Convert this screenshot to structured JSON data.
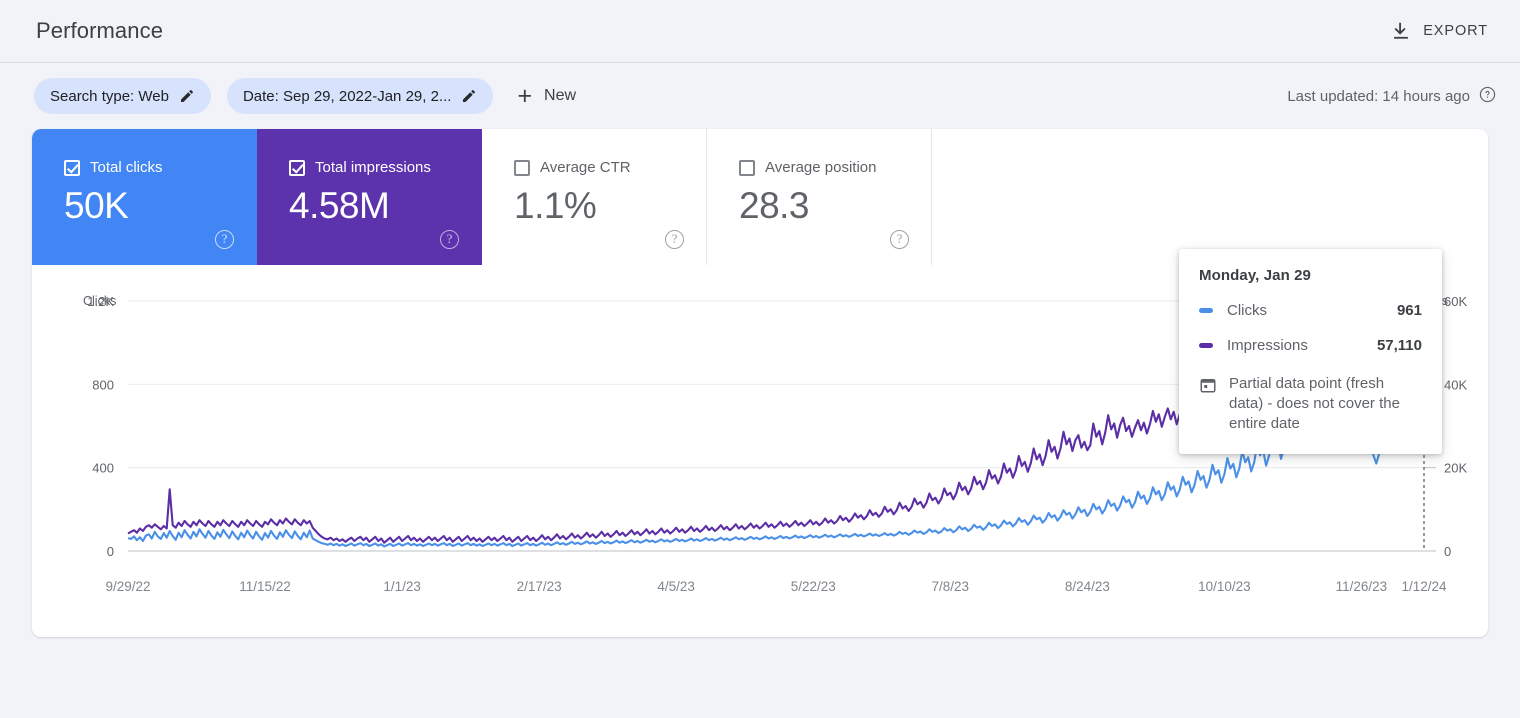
{
  "header": {
    "title": "Performance",
    "export_label": "EXPORT",
    "export_icon": "download-icon"
  },
  "filters": {
    "chips": [
      {
        "label": "Search type: Web",
        "icon": "pencil-icon"
      },
      {
        "label": "Date: Sep 29, 2022-Jan 29, 2...",
        "icon": "pencil-icon"
      }
    ],
    "new_label": "New",
    "new_icon": "plus-icon",
    "last_updated": "Last updated: 14 hours ago",
    "help_icon": "help-circle-icon"
  },
  "metrics": [
    {
      "name": "total-clicks",
      "label": "Total clicks",
      "value": "50K",
      "checked": true,
      "style": "blue",
      "color": "#4285f4"
    },
    {
      "name": "total-impressions",
      "label": "Total impressions",
      "value": "4.58M",
      "checked": true,
      "style": "purple",
      "color": "#5c33ad"
    },
    {
      "name": "average-ctr",
      "label": "Average CTR",
      "value": "1.1%",
      "checked": false,
      "style": "plain",
      "color": "#5f6368"
    },
    {
      "name": "average-position",
      "label": "Average position",
      "value": "28.3",
      "checked": false,
      "style": "plain",
      "color": "#5f6368"
    }
  ],
  "tooltip": {
    "title": "Monday, Jan 29",
    "rows": [
      {
        "name": "Clicks",
        "value": "961",
        "color": "#4a90e8"
      },
      {
        "name": "Impressions",
        "value": "57,110",
        "color": "#5b2ea6"
      }
    ],
    "note": "Partial data point (fresh data) - does not cover the entire date",
    "note_icon": "calendar-icon"
  },
  "chart_data": {
    "type": "line",
    "title": "",
    "xlabel": "",
    "ylabel": "Clicks",
    "y2label": "Impressions",
    "grid": true,
    "legend": "none",
    "y_left_ticks": [
      "0",
      "400",
      "800",
      "1.2K"
    ],
    "y_left_values": [
      0,
      400,
      800,
      1200
    ],
    "ylim": [
      0,
      1200
    ],
    "y_right_ticks": [
      "0",
      "20K",
      "40K",
      "60K"
    ],
    "y_right_values": [
      0,
      20000,
      40000,
      60000
    ],
    "y2lim": [
      0,
      60000
    ],
    "x_ticks": [
      "9/29/22",
      "11/15/22",
      "1/1/23",
      "2/17/23",
      "4/5/23",
      "5/22/23",
      "7/8/23",
      "8/24/23",
      "10/10/23",
      "11/26/23",
      "1/12/24"
    ],
    "x_range": [
      "9/29/22",
      "1/29/24"
    ],
    "highlight": {
      "x": "1/29/24",
      "clicks": 961,
      "impressions": 57110
    },
    "series": [
      {
        "name": "Clicks",
        "color": "#4a90e8",
        "axis": "left",
        "values": [
          62,
          58,
          70,
          52,
          66,
          48,
          74,
          80,
          60,
          92,
          70,
          58,
          86,
          64,
          96,
          72,
          54,
          88,
          66,
          100,
          78,
          60,
          92,
          70,
          104,
          82,
          64,
          96,
          74,
          58,
          90,
          68,
          102,
          80,
          62,
          94,
          72,
          56,
          88,
          66,
          98,
          76,
          60,
          92,
          70,
          54,
          86,
          64,
          96,
          74,
          58,
          90,
          68,
          100,
          78,
          62,
          94,
          72,
          56,
          88,
          66,
          98,
          60,
          52,
          44,
          38,
          34,
          30,
          36,
          28,
          34,
          26,
          32,
          24,
          30,
          36,
          26,
          32,
          38,
          28,
          34,
          24,
          30,
          36,
          26,
          32,
          22,
          28,
          34,
          24,
          30,
          36,
          26,
          32,
          38,
          28,
          34,
          26,
          32,
          24,
          30,
          36,
          28,
          34,
          26,
          32,
          38,
          28,
          34,
          24,
          30,
          36,
          26,
          32,
          38,
          28,
          34,
          26,
          32,
          24,
          30,
          36,
          28,
          34,
          26,
          32,
          38,
          28,
          34,
          24,
          30,
          36,
          26,
          32,
          38,
          28,
          34,
          26,
          32,
          40,
          30,
          36,
          28,
          34,
          42,
          32,
          38,
          30,
          36,
          44,
          34,
          40,
          32,
          38,
          46,
          36,
          42,
          34,
          40,
          48,
          38,
          44,
          36,
          42,
          50,
          40,
          46,
          38,
          44,
          52,
          42,
          48,
          40,
          46,
          54,
          44,
          50,
          42,
          48,
          56,
          46,
          52,
          44,
          50,
          58,
          48,
          54,
          46,
          52,
          60,
          50,
          56,
          48,
          54,
          62,
          52,
          58,
          50,
          56,
          64,
          54,
          60,
          52,
          58,
          66,
          56,
          62,
          54,
          60,
          68,
          58,
          64,
          56,
          62,
          70,
          60,
          66,
          58,
          64,
          72,
          62,
          68,
          60,
          66,
          74,
          64,
          70,
          62,
          68,
          76,
          66,
          72,
          64,
          70,
          78,
          68,
          74,
          66,
          72,
          80,
          70,
          76,
          68,
          74,
          82,
          72,
          78,
          70,
          76,
          84,
          74,
          80,
          72,
          78,
          86,
          76,
          82,
          74,
          80,
          92,
          82,
          88,
          78,
          86,
          98,
          88,
          94,
          82,
          90,
          104,
          92,
          98,
          86,
          94,
          110,
          98,
          104,
          90,
          100,
          118,
          104,
          112,
          96,
          106,
          126,
          112,
          118,
          102,
          114,
          136,
          120,
          128,
          110,
          122,
          146,
          130,
          138,
          118,
          132,
          158,
          140,
          148,
          126,
          142,
          170,
          152,
          160,
          136,
          152,
          182,
          162,
          172,
          146,
          164,
          196,
          174,
          184,
          156,
          176,
          210,
          186,
          198,
          168,
          188,
          226,
          200,
          212,
          180,
          202,
          244,
          216,
          228,
          194,
          218,
          262,
          234,
          246,
          208,
          234,
          284,
          252,
          266,
          226,
          252,
          306,
          272,
          288,
          244,
          272,
          330,
          294,
          310,
          262,
          294,
          356,
          318,
          334,
          282,
          318,
          384,
          342,
          360,
          304,
          342,
          414,
          368,
          388,
          328,
          368,
          446,
          396,
          418,
          354,
          396,
          480,
          426,
          450,
          382,
          426,
          516,
          460,
          484,
          410,
          458,
          554,
          494,
          520,
          442,
          492,
          596,
          530,
          560,
          474,
          530,
          640,
          570,
          600,
          510,
          570,
          688,
          612,
          646,
          548,
          612,
          660,
          700,
          640,
          690,
          720,
          700,
          660,
          710,
          730,
          700,
          660,
          620,
          560,
          500,
          460,
          420,
          470,
          520,
          560,
          620,
          680,
          720,
          780,
          840,
          900,
          870,
          820,
          840,
          880,
          920,
          880,
          961
        ]
      },
      {
        "name": "Impressions",
        "color": "#5b2ea6",
        "axis": "right",
        "values": [
          4200,
          4600,
          5000,
          4400,
          5400,
          4800,
          5800,
          6200,
          5600,
          6400,
          5800,
          5200,
          6000,
          5400,
          14800,
          6200,
          5600,
          6800,
          6000,
          7200,
          6400,
          5800,
          7000,
          6200,
          7400,
          6600,
          6000,
          7200,
          6400,
          5800,
          7000,
          6200,
          7400,
          6600,
          6000,
          7200,
          6400,
          5800,
          7000,
          6200,
          7400,
          6600,
          6000,
          7200,
          6400,
          5800,
          7000,
          6400,
          7600,
          6800,
          6200,
          7400,
          6600,
          7800,
          7000,
          6400,
          7600,
          6800,
          6200,
          7400,
          6600,
          7200,
          5600,
          4800,
          4000,
          3400,
          3000,
          2800,
          3200,
          2600,
          3000,
          2400,
          2800,
          2200,
          2800,
          3200,
          2400,
          3000,
          3400,
          2600,
          3200,
          2200,
          2800,
          3400,
          2400,
          3000,
          2000,
          2600,
          3200,
          2200,
          2800,
          3400,
          2400,
          3000,
          3600,
          2600,
          3200,
          2400,
          3000,
          2200,
          2800,
          3400,
          2600,
          3200,
          2400,
          3000,
          3600,
          2600,
          3200,
          2200,
          2800,
          3400,
          2400,
          3000,
          3600,
          2600,
          3200,
          2400,
          3000,
          2200,
          2800,
          3400,
          2600,
          3200,
          2400,
          3000,
          3600,
          2600,
          3200,
          2200,
          2800,
          3400,
          2400,
          3000,
          3600,
          2600,
          3200,
          2400,
          3000,
          3800,
          2800,
          3400,
          2600,
          3200,
          4000,
          3000,
          3600,
          2800,
          3400,
          4200,
          3200,
          3800,
          3000,
          3600,
          4400,
          3400,
          4000,
          3200,
          3800,
          4600,
          3600,
          4200,
          3400,
          4000,
          4800,
          3800,
          4400,
          3600,
          4200,
          5000,
          4000,
          4600,
          3800,
          4400,
          5200,
          4200,
          4800,
          4000,
          4600,
          5400,
          4400,
          5000,
          4200,
          4800,
          5600,
          4600,
          5200,
          4400,
          5000,
          5800,
          4800,
          5400,
          4600,
          5200,
          6000,
          5000,
          5600,
          4800,
          5400,
          6200,
          5200,
          5800,
          5000,
          5600,
          6400,
          5400,
          6000,
          5200,
          5800,
          6600,
          5600,
          6200,
          5400,
          6000,
          6800,
          5800,
          6400,
          5600,
          6200,
          7000,
          6000,
          6600,
          5800,
          6400,
          7200,
          6200,
          6800,
          6000,
          6600,
          7400,
          6400,
          7000,
          6200,
          6800,
          7800,
          6800,
          7400,
          6600,
          7200,
          8400,
          7400,
          8000,
          7000,
          7800,
          9000,
          8000,
          8600,
          7600,
          8400,
          9800,
          8600,
          9200,
          8200,
          9000,
          10600,
          9400,
          10000,
          8800,
          9800,
          11600,
          10200,
          10800,
          9600,
          10600,
          12600,
          11200,
          11800,
          10400,
          11600,
          13800,
          12200,
          12800,
          11400,
          12600,
          15000,
          13400,
          14000,
          12400,
          13800,
          16400,
          14600,
          15400,
          13600,
          15000,
          17800,
          16000,
          16800,
          14800,
          16400,
          19400,
          17400,
          18200,
          16200,
          17800,
          21000,
          18800,
          19800,
          17600,
          19400,
          22800,
          20400,
          21400,
          19000,
          21000,
          24600,
          22000,
          23200,
          20600,
          22800,
          26600,
          23800,
          25000,
          22200,
          24600,
          28600,
          25600,
          27000,
          24000,
          26600,
          27800,
          24800,
          26200,
          24200,
          25400,
          30600,
          27400,
          28800,
          25600,
          28400,
          32600,
          29200,
          30600,
          27200,
          30200,
          32000,
          28800,
          30000,
          27400,
          29600,
          31400,
          29000,
          30800,
          28200,
          30400,
          33600,
          31000,
          32800,
          29800,
          32200,
          34200,
          31600,
          33400,
          30400,
          32800,
          31000,
          29400,
          33200,
          36000,
          34400,
          37800,
          39600,
          37400,
          35600,
          38400,
          40200,
          38000,
          35800,
          33400,
          31000,
          34200,
          36800,
          34000,
          36200,
          38400,
          36600,
          39400,
          42200,
          44800,
          47000,
          49600,
          52200,
          50000,
          47400,
          49800,
          53400,
          51200,
          55600,
          57110
        ]
      }
    ]
  }
}
